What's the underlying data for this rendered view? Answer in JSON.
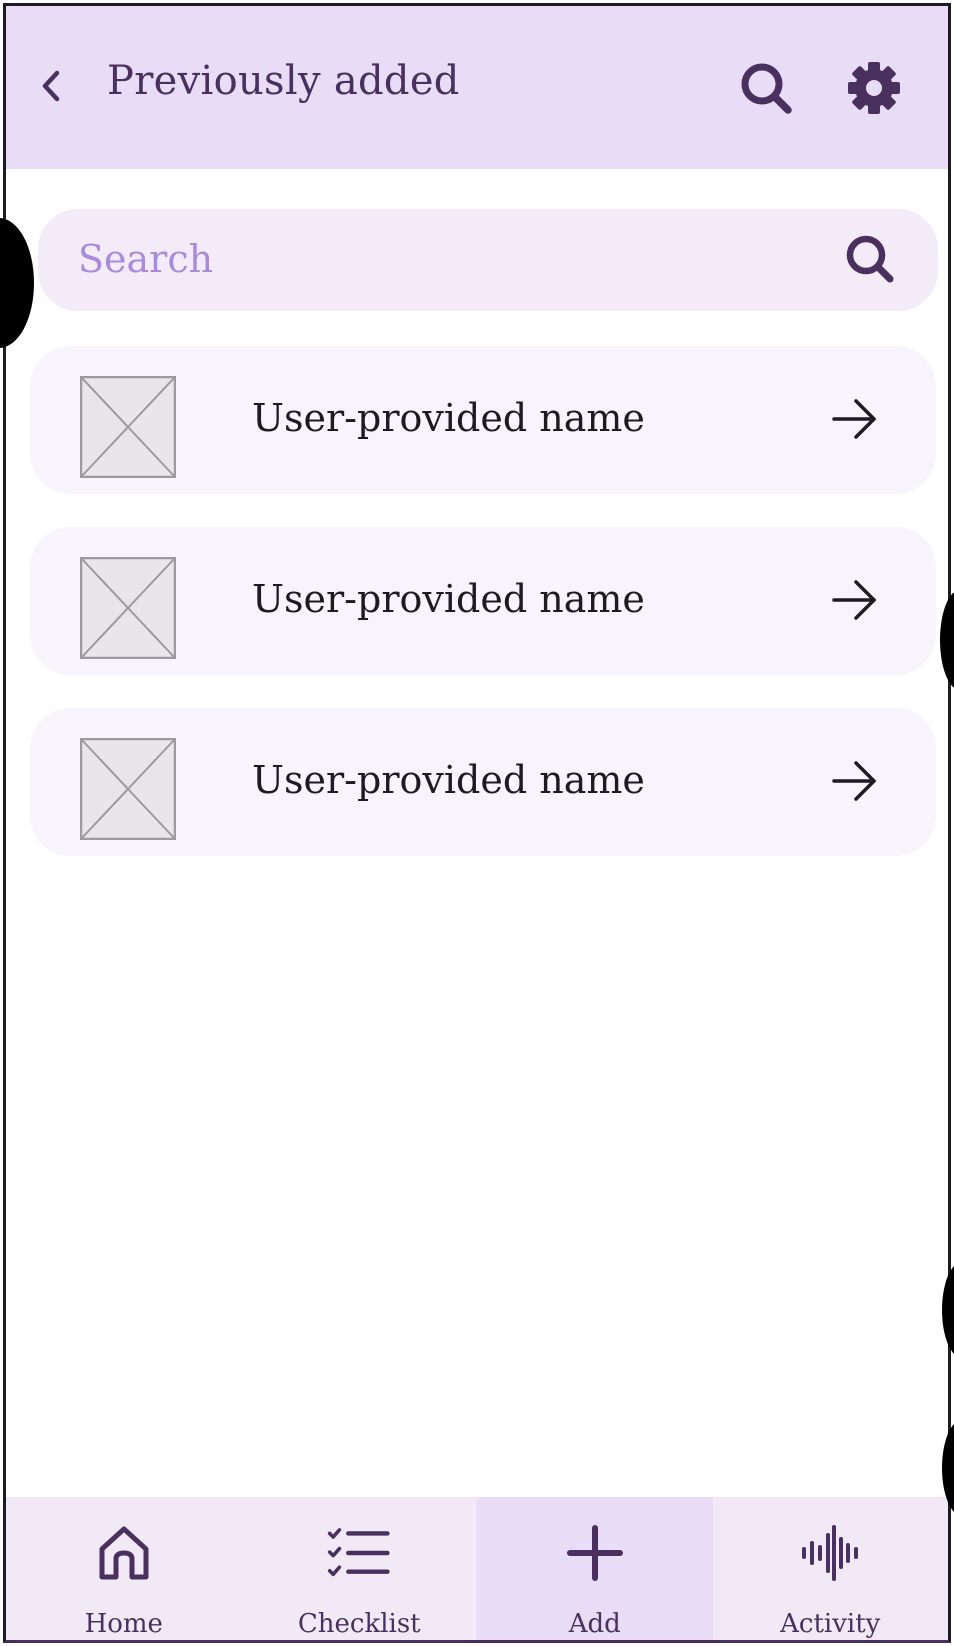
{
  "header": {
    "title": "Previously added",
    "back_icon": "chevron-left-icon",
    "search_icon": "search-icon",
    "settings_icon": "gear-icon"
  },
  "search": {
    "placeholder": "Search",
    "value": ""
  },
  "items": [
    {
      "name": "User-provided name"
    },
    {
      "name": "User-provided name"
    },
    {
      "name": "User-provided name"
    }
  ],
  "nav": {
    "items": [
      {
        "label": "Home",
        "icon": "home-icon",
        "active": false
      },
      {
        "label": "Checklist",
        "icon": "checklist-icon",
        "active": false
      },
      {
        "label": "Add",
        "icon": "plus-icon",
        "active": true
      },
      {
        "label": "Activity",
        "icon": "audio-wave-icon",
        "active": false
      }
    ]
  },
  "colors": {
    "app_bar": "#e8dcf6",
    "primary": "#49305f",
    "placeholder": "#a98adb",
    "card": "#f8f4fb",
    "nav_bg": "#f1eaf6",
    "nav_active": "#e8dcf6"
  }
}
